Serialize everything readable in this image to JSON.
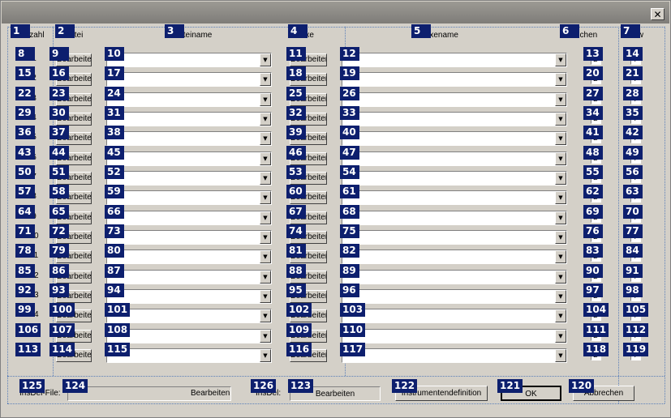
{
  "window": {
    "close_glyph": "✕"
  },
  "headers": {
    "anzahl": "Anzahl",
    "datei": "Datei",
    "dateiname": "Dateiname",
    "fixe": "Fixe",
    "fixename": "Fixename",
    "suchen": "suchen",
    "new": "New"
  },
  "common": {
    "bearbeiten": "Bearbeiten",
    "dropdown_glyph": "▼",
    "check_mark": "B",
    "new_mark": "T"
  },
  "rows": [
    {
      "number": "1",
      "file": "",
      "fixe": ""
    },
    {
      "number": "2",
      "file": "",
      "fixe": ""
    },
    {
      "number": "3",
      "file": "",
      "fixe": ""
    },
    {
      "number": "4",
      "file": "",
      "fixe": ""
    },
    {
      "number": "5",
      "file": "",
      "fixe": ""
    },
    {
      "number": "6",
      "file": "",
      "fixe": ""
    },
    {
      "number": "7",
      "file": "",
      "fixe": ""
    },
    {
      "number": "8",
      "file": "",
      "fixe": ""
    },
    {
      "number": "9",
      "file": "",
      "fixe": ""
    },
    {
      "number": "10",
      "file": "",
      "fixe": ""
    },
    {
      "number": "11",
      "file": "",
      "fixe": ""
    },
    {
      "number": "12",
      "file": "",
      "fixe": ""
    },
    {
      "number": "13",
      "file": "",
      "fixe": ""
    },
    {
      "number": "14",
      "file": "",
      "fixe": ""
    },
    {
      "number": "15",
      "file": "",
      "fixe": ""
    },
    {
      "number": "16",
      "file": "",
      "fixe": ""
    }
  ],
  "footer": {
    "insdel_file_label": "InsDel-File:",
    "insdel_file_value": "",
    "insdel_file_button": "Bearbeiten",
    "insdel_label": "InsDel:",
    "insdel_button": "Bearbeiten",
    "instrument_button": "Instrumentendefinition",
    "ok_button": "OK",
    "cancel_button": "Abbrechen"
  },
  "annotations": {
    "header_badges": [
      "1",
      "2",
      "3",
      "4",
      "5",
      "6",
      "7"
    ],
    "row_badges": [
      [
        "8",
        "9",
        "10",
        "11",
        "12",
        "13",
        "14"
      ],
      [
        "15",
        "16",
        "17",
        "18",
        "19",
        "20",
        "21"
      ],
      [
        "22",
        "23",
        "24",
        "25",
        "26",
        "27",
        "28"
      ],
      [
        "29",
        "30",
        "31",
        "32",
        "33",
        "34",
        "35"
      ],
      [
        "36",
        "37",
        "38",
        "39",
        "40",
        "41",
        "42"
      ],
      [
        "43",
        "44",
        "45",
        "46",
        "47",
        "48",
        "49"
      ],
      [
        "50",
        "51",
        "52",
        "53",
        "54",
        "55",
        "56"
      ],
      [
        "57",
        "58",
        "59",
        "60",
        "61",
        "62",
        "63"
      ],
      [
        "64",
        "65",
        "66",
        "67",
        "68",
        "69",
        "70"
      ],
      [
        "71",
        "72",
        "73",
        "74",
        "75",
        "76",
        "77"
      ],
      [
        "78",
        "79",
        "80",
        "81",
        "82",
        "83",
        "84"
      ],
      [
        "85",
        "86",
        "87",
        "88",
        "89",
        "90",
        "91"
      ],
      [
        "92",
        "93",
        "94",
        "95",
        "96",
        "97",
        "98"
      ],
      [
        "99",
        "100",
        "101",
        "102",
        "103",
        "104",
        "105"
      ],
      [
        "106",
        "107",
        "108",
        "109",
        "110",
        "111",
        "112"
      ],
      [
        "113",
        "114",
        "115",
        "116",
        "117",
        "118",
        "119"
      ]
    ],
    "footer_badges": {
      "insdel_file_label": "125",
      "insdel_file_field": "124",
      "insdel_label": "126",
      "insdel_button": "123",
      "instrument_button": "122",
      "ok_button": "121",
      "cancel_button": "120"
    },
    "badge_color": "#0d1f6e"
  }
}
